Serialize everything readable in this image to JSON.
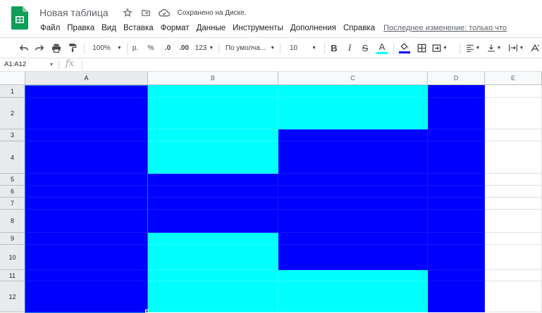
{
  "header": {
    "doc_title": "Новая таблица",
    "saved_status": "Сохранено на Диске.",
    "menu": [
      "Файл",
      "Правка",
      "Вид",
      "Вставка",
      "Формат",
      "Данные",
      "Инструменты",
      "Дополнения",
      "Справка"
    ],
    "last_edit": "Последнее изменение: только что"
  },
  "toolbar": {
    "zoom": "100%",
    "currency": "р.",
    "percent": "%",
    "decrease_decimals": ".0",
    "increase_decimals": ".00",
    "more_formats": "123",
    "font_family": "По умолча...",
    "font_size": "10",
    "bold": "B",
    "italic": "I",
    "strikethrough": "S",
    "text_color_letter": "A",
    "text_color": "#00ffff",
    "fill_color": "#0000ee"
  },
  "formula_bar": {
    "name_box": "A1:A12",
    "fx": "fx",
    "content": ""
  },
  "sheet": {
    "columns": [
      "A",
      "B",
      "C",
      "D",
      "E"
    ],
    "rows": [
      "1",
      "2",
      "3",
      "4",
      "5",
      "6",
      "7",
      "8",
      "9",
      "10",
      "11",
      "12"
    ],
    "selected_range": "A1:A12",
    "colors": {
      "b": "#0000ff",
      "c": "#00ffff",
      "w": "#ffffff"
    },
    "fills": [
      [
        "b",
        "c",
        "c",
        "b",
        "w"
      ],
      [
        "b",
        "c",
        "c",
        "b",
        "w"
      ],
      [
        "b",
        "c",
        "b",
        "b",
        "w"
      ],
      [
        "b",
        "c",
        "b",
        "b",
        "w"
      ],
      [
        "b",
        "b",
        "b",
        "b",
        "w"
      ],
      [
        "b",
        "b",
        "b",
        "b",
        "w"
      ],
      [
        "b",
        "b",
        "b",
        "b",
        "w"
      ],
      [
        "b",
        "b",
        "b",
        "b",
        "w"
      ],
      [
        "b",
        "c",
        "b",
        "b",
        "w"
      ],
      [
        "b",
        "c",
        "b",
        "b",
        "w"
      ],
      [
        "b",
        "c",
        "c",
        "b",
        "w"
      ],
      [
        "b",
        "c",
        "c",
        "b",
        "w"
      ]
    ]
  }
}
